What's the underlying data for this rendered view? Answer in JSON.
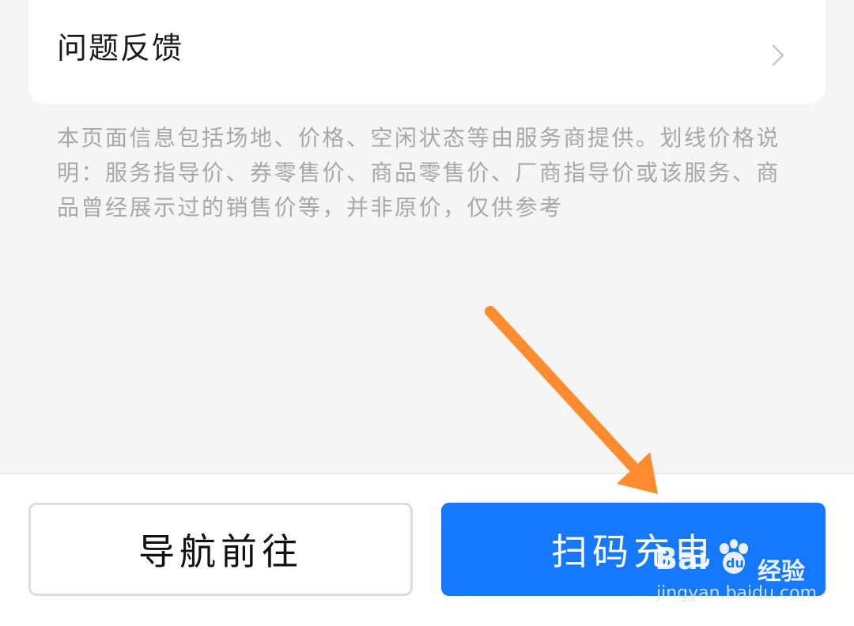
{
  "feedback": {
    "label": "问题反馈",
    "icon": "chevron-right-icon"
  },
  "disclaimer": {
    "text": "本页面信息包括场地、价格、空闲状态等由服务商提供。划线价格说明：服务指导价、券零售价、商品零售价、厂商指导价或该服务、商品曾经展示过的销售价等，并非原价，仅供参考"
  },
  "actions": {
    "navigate_label": "导航前往",
    "scan_charge_label": "扫码充电"
  },
  "overlay": {
    "arrow_color": "#ff8c2e",
    "watermark_brand": "Bai du",
    "watermark_cn": "经验",
    "watermark_url": "jingyan.baidu.com"
  },
  "colors": {
    "background": "#f5f5f5",
    "primary_button": "#1677ff",
    "disclaimer_text": "#a8a8a8"
  }
}
